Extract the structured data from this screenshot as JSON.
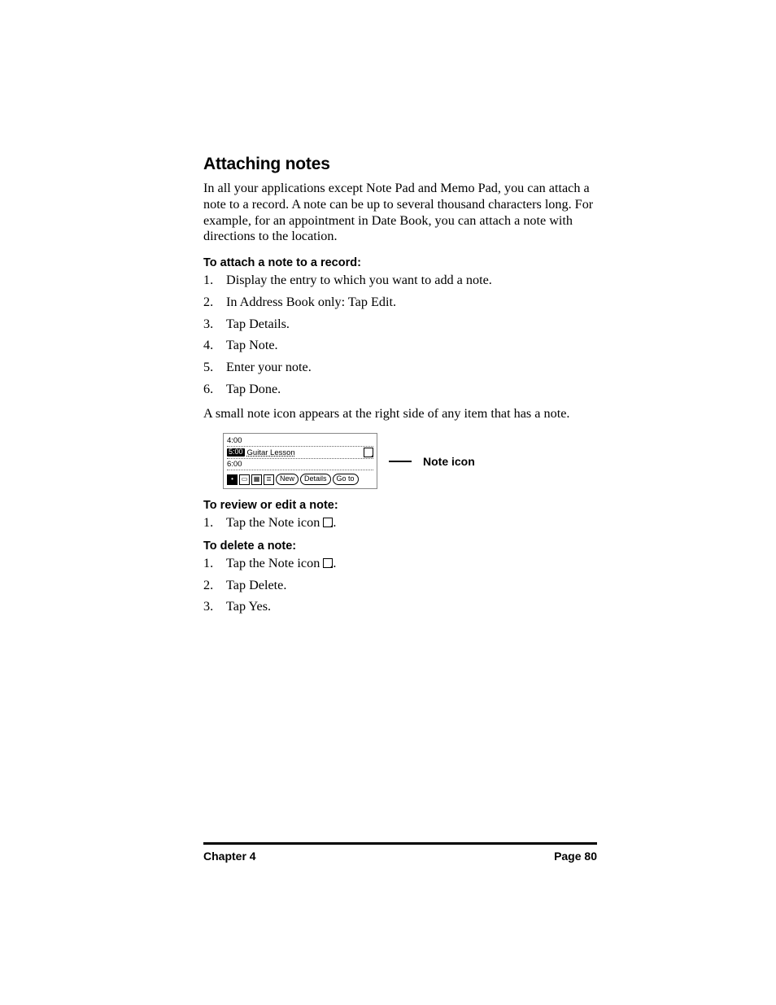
{
  "heading": "Attaching notes",
  "intro": "In all your applications except Note Pad and Memo Pad, you can attach a note to a record. A note can be up to several thousand characters long. For example, for an appointment in Date Book, you can attach a note with directions to the location.",
  "attach": {
    "title": "To attach a note to a record:",
    "steps": [
      "Display the entry to which you want to add a note.",
      "In Address Book only: Tap Edit.",
      "Tap Details.",
      "Tap Note.",
      "Enter your note.",
      "Tap Done."
    ]
  },
  "result_line": "A small note icon appears at the right side of any item that has a note.",
  "figure": {
    "t1": "4:00",
    "t2": "5:00",
    "t2txt": "Guitar Lesson",
    "t3": "6:00",
    "btn_new": "New",
    "btn_details": "Details",
    "btn_goto": "Go to",
    "callout": "Note icon"
  },
  "review": {
    "title": "To review or edit a note:",
    "step1_pre": "Tap the Note icon ",
    "step1_post": "."
  },
  "del": {
    "title": "To delete a note:",
    "step1_pre": "Tap the Note icon ",
    "step1_post": ".",
    "s2": "Tap Delete.",
    "s3": "Tap Yes."
  },
  "footer": {
    "left": "Chapter 4",
    "right": "Page 80"
  }
}
